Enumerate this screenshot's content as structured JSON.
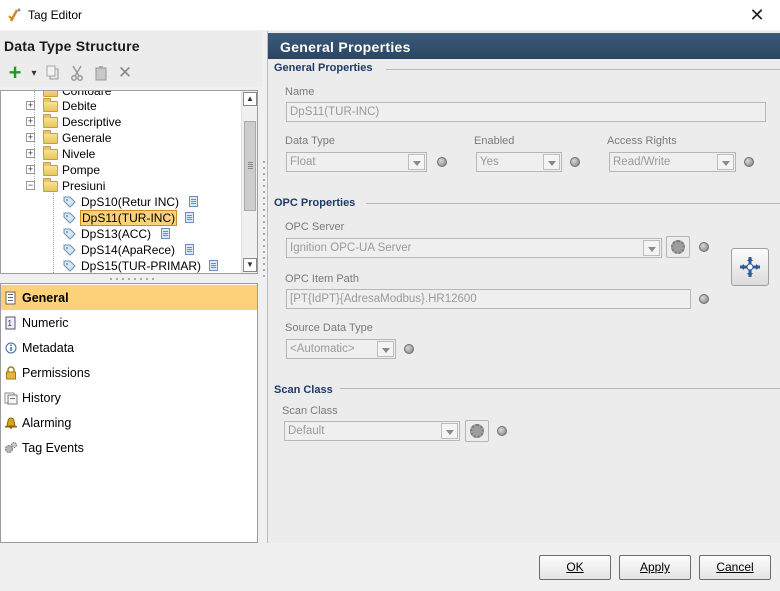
{
  "window": {
    "title": "Tag Editor",
    "close_glyph": "✕"
  },
  "left_panel": {
    "heading": "Data Type Structure",
    "toolbar": {
      "icons": [
        "add-icon",
        "dropdown-arrow-icon",
        "copy-icon",
        "cut-icon",
        "paste-icon",
        "delete-icon"
      ],
      "add_glyph": "+",
      "dropdown_glyph": "▾",
      "delete_glyph": "✕"
    },
    "tree": {
      "partial_top": "Contoare",
      "folders": [
        "Debite",
        "Descriptive",
        "Generale",
        "Nivele",
        "Pompe",
        "Presiuni"
      ],
      "expanded_folder": "Presiuni",
      "tags": [
        "DpS10(Retur INC)",
        "DpS11(TUR-INC)",
        "DpS13(ACC)",
        "DpS14(ApaRece)",
        "DpS15(TUR-PRIMAR)"
      ],
      "selected_tag": "DpS11(TUR-INC)",
      "expander_plus": "+",
      "expander_minus": "−",
      "scroll_up": "▲",
      "scroll_down": "▼"
    },
    "nav": [
      {
        "label": "General",
        "icon": "general-icon",
        "active": true
      },
      {
        "label": "Numeric",
        "icon": "numeric-icon",
        "active": false
      },
      {
        "label": "Metadata",
        "icon": "metadata-icon",
        "active": false
      },
      {
        "label": "Permissions",
        "icon": "lock-icon",
        "active": false
      },
      {
        "label": "History",
        "icon": "history-icon",
        "active": false
      },
      {
        "label": "Alarming",
        "icon": "bell-icon",
        "active": false
      },
      {
        "label": "Tag Events",
        "icon": "gears-icon",
        "active": false
      }
    ]
  },
  "right_panel": {
    "header": "General Properties",
    "general": {
      "section_title": "General Properties",
      "name_label": "Name",
      "name_value": "DpS11(TUR-INC)",
      "data_type_label": "Data Type",
      "data_type_value": "Float",
      "enabled_label": "Enabled",
      "enabled_value": "Yes",
      "access_rights_label": "Access Rights",
      "access_rights_value": "Read/Write"
    },
    "opc": {
      "section_title": "OPC Properties",
      "server_label": "OPC Server",
      "server_value": "Ignition OPC-UA Server",
      "item_path_label": "OPC Item Path",
      "item_path_value": "[PT{IdPT}{AdresaModbus}.HR12600",
      "source_type_label": "Source Data Type",
      "source_type_value": "<Automatic>"
    },
    "scan": {
      "section_title": "Scan Class",
      "scan_label": "Scan Class",
      "scan_value": "Default"
    }
  },
  "footer": {
    "ok_label": "OK",
    "apply_label": "Apply",
    "cancel_label": "Cancel"
  },
  "colors": {
    "selection": "#fbd27a",
    "header_bg": "#2f4b68",
    "section_title": "#1f3a66"
  }
}
